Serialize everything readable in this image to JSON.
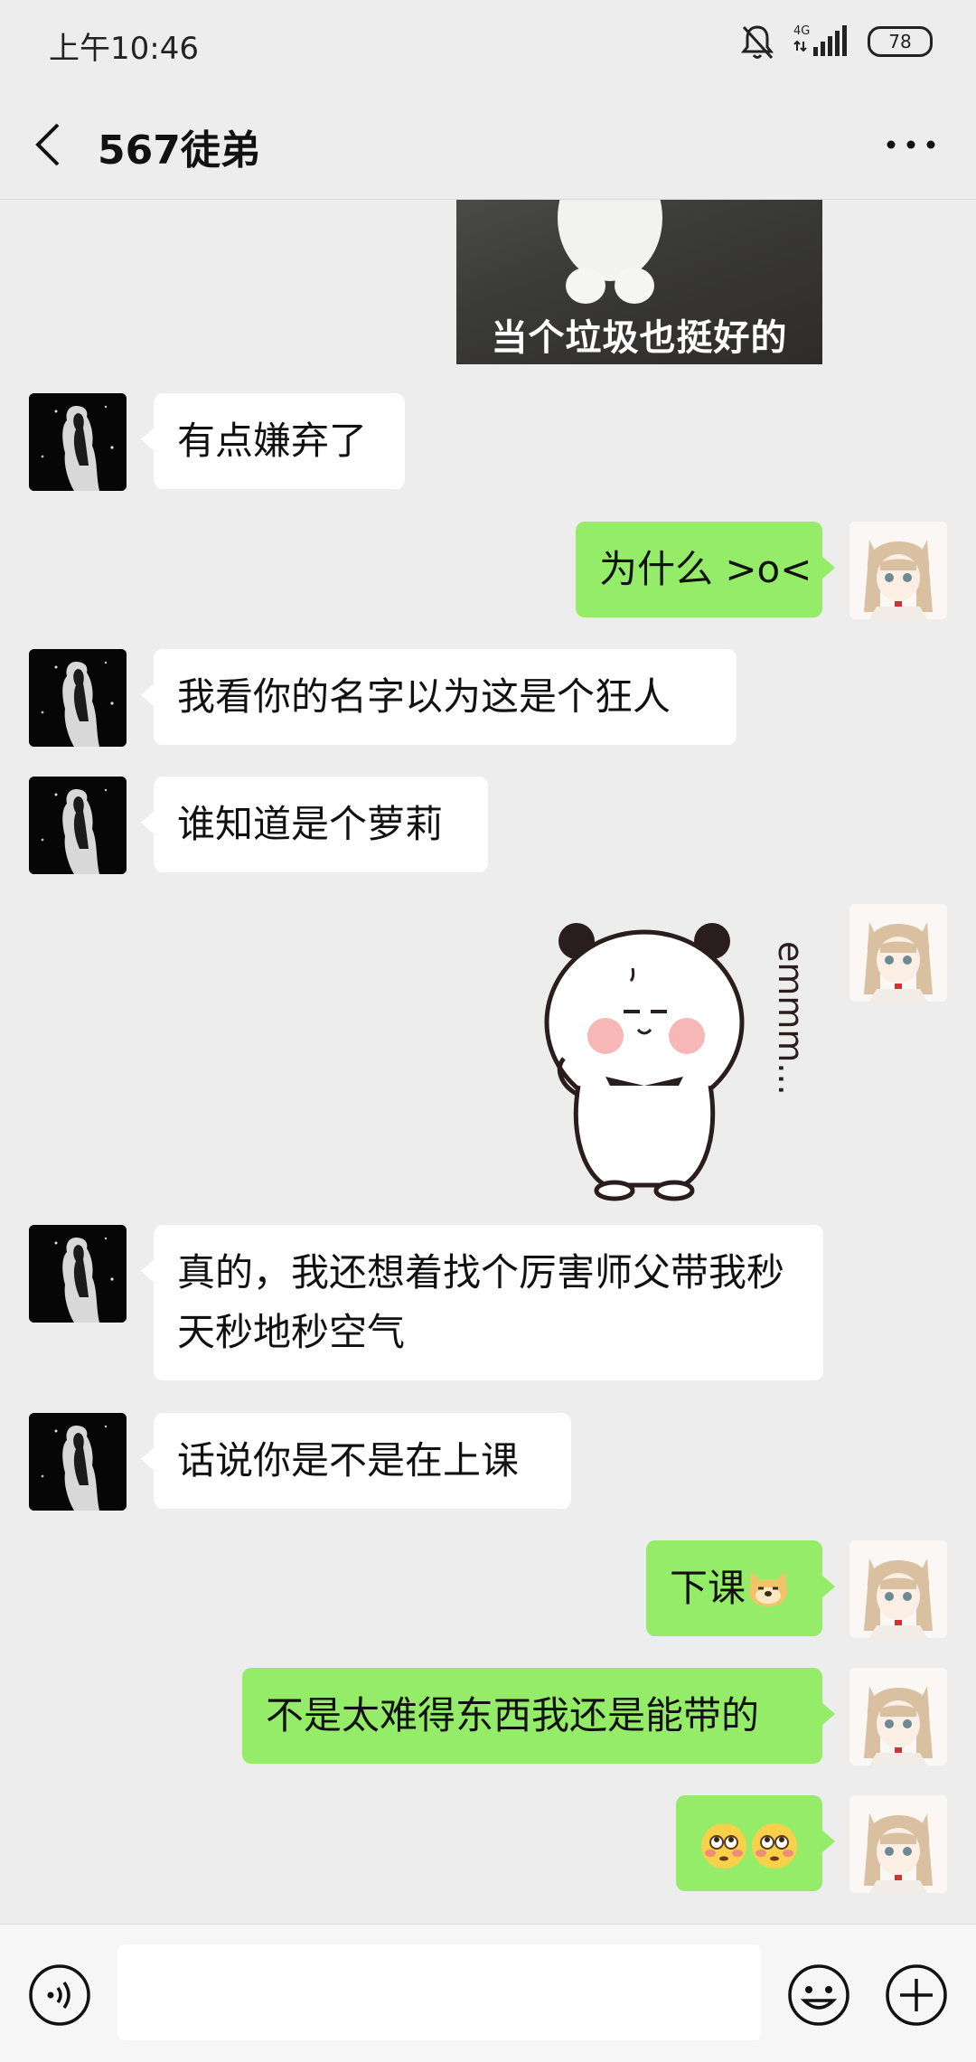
{
  "status": {
    "time": "上午10:46",
    "network": "4G",
    "battery": "78"
  },
  "header": {
    "title": "567徒弟"
  },
  "chat": {
    "top_sticker_caption": "当个垃圾也挺好的",
    "messages": [
      {
        "side": "in",
        "text": "有点嫌弃了"
      },
      {
        "side": "out",
        "text": "为什么 >o<"
      },
      {
        "side": "in",
        "text": "我看你的名字以为这是个狂人"
      },
      {
        "side": "in",
        "text": "谁知道是个萝莉"
      },
      {
        "side": "out",
        "sticker": "panda-emmm-sticker",
        "sticker_text": "emmm..."
      },
      {
        "side": "in",
        "text": "真的，我还想着找个厉害师父带我秒天秒地秒空气"
      },
      {
        "side": "in",
        "text": "话说你是不是在上课"
      },
      {
        "side": "out",
        "text": "下课",
        "emoji": "doge-emoji"
      },
      {
        "side": "out",
        "text": "不是太难得东西我还是能带的"
      },
      {
        "side": "out",
        "emoji": "flushed-face-emoji x2"
      }
    ]
  },
  "colors": {
    "background": "#ededed",
    "incoming_bubble": "#ffffff",
    "outgoing_bubble": "#95ec69"
  },
  "input": {
    "placeholder": ""
  }
}
